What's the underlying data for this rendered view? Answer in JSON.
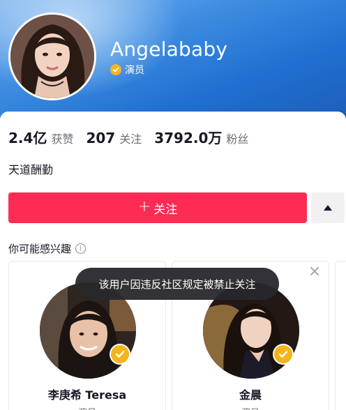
{
  "profile": {
    "username": "Angelababy",
    "verified_label": "演员",
    "bio": "天道酬勤"
  },
  "stats": [
    {
      "value": "2.4亿",
      "label": "获赞"
    },
    {
      "value": "207",
      "label": "关注"
    },
    {
      "value": "3792.0万",
      "label": "粉丝"
    }
  ],
  "actions": {
    "follow_label": "关注",
    "follow_plus": "+"
  },
  "suggestions": {
    "title": "你可能感兴趣",
    "items": [
      {
        "name": "李庚希 Teresa",
        "role": "演员"
      },
      {
        "name": "金晨",
        "role": "演员"
      }
    ]
  },
  "toast": {
    "message": "该用户因违反社区规定被禁止关注"
  },
  "colors": {
    "follow_button": "#fe2c55",
    "header_blue": "#1f6fd1",
    "verified_gold": "#f5b41c"
  }
}
